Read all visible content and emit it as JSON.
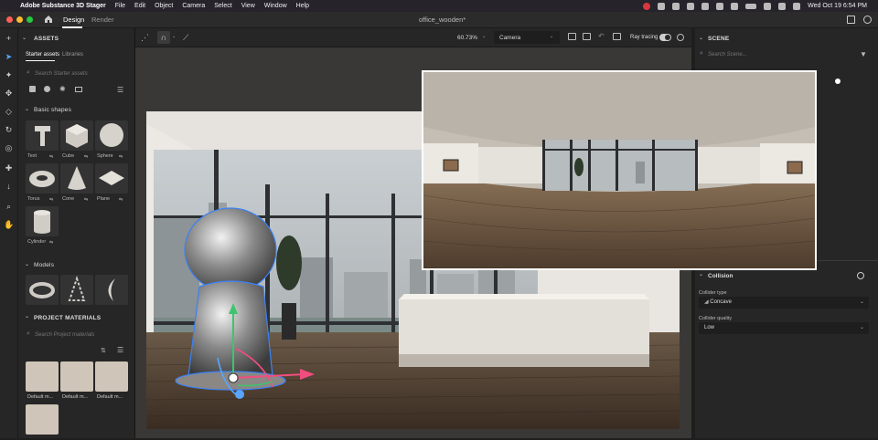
{
  "menubar": {
    "app_name": "Adobe Substance 3D Stager",
    "items": [
      "File",
      "Edit",
      "Object",
      "Camera",
      "Select",
      "View",
      "Window",
      "Help"
    ],
    "clock": "Wed Oct 19  6:54 PM"
  },
  "titlebar": {
    "tab_design": "Design",
    "tab_render": "Render",
    "document_title": "office_wooden*"
  },
  "toolbar": {
    "zoom": "60.73%",
    "camera_select": "Camera",
    "ray_tracing_label": "Ray tracing"
  },
  "assets": {
    "header": "ASSETS",
    "tab_starter": "Starter assets",
    "tab_libraries": "Libraries",
    "search_placeholder": "Search Starter assets",
    "basic_shapes_header": "Basic shapes",
    "shapes": [
      "Text",
      "Cube",
      "Sphere",
      "Torus",
      "Cone",
      "Plane",
      "Cylinder"
    ],
    "models_header": "Models",
    "project_materials_header": "PROJECT MATERIALS",
    "materials_search_placeholder": "Search Project materials",
    "materials": [
      "Default m...",
      "Default m...",
      "Default m..."
    ]
  },
  "scene": {
    "header": "SCENE",
    "search_placeholder": "Search Scene...",
    "collision_header": "Collision",
    "collider_type_label": "Collider type",
    "collider_type_value": "Concave",
    "collider_quality_label": "Collider quality",
    "collider_quality_value": "Low"
  },
  "colors": {
    "accent": "#2680eb",
    "panel": "#262626",
    "menubar": "#26232b"
  }
}
